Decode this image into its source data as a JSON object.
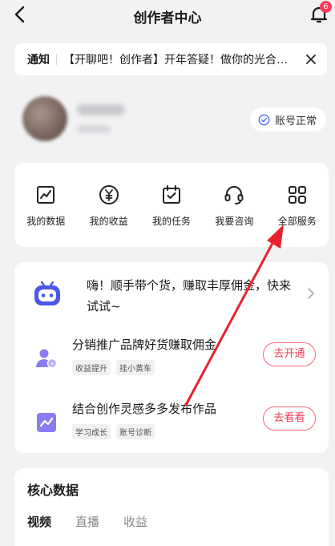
{
  "header": {
    "title": "创作者中心",
    "notification_count": "6"
  },
  "notice": {
    "tag": "通知",
    "text": "【开聊吧！创作者】开年答疑！做你的光合…"
  },
  "profile": {
    "status_label": "账号正常"
  },
  "services": [
    {
      "label": "我的数据",
      "icon": "chart-icon"
    },
    {
      "label": "我的收益",
      "icon": "yen-icon"
    },
    {
      "label": "我的任务",
      "icon": "task-icon"
    },
    {
      "label": "我要咨询",
      "icon": "headset-icon"
    },
    {
      "label": "全部服务",
      "icon": "grid-icon"
    }
  ],
  "promo": {
    "text": "嗨！顺手带个货，赚取丰厚佣金，快来试试~",
    "rows": [
      {
        "title": "分销推广品牌好货赚取佣金",
        "tags": [
          "收益提升",
          "挂小黄车"
        ],
        "button": "去开通",
        "icon": "user-coin-icon"
      },
      {
        "title": "结合创作灵感多多发布作品",
        "tags": [
          "学习成长",
          "账号诊断"
        ],
        "button": "去看看",
        "icon": "trend-icon"
      }
    ]
  },
  "core": {
    "title": "核心数据",
    "tabs": [
      "视频",
      "直播",
      "收益"
    ]
  },
  "colors": {
    "accent": "#ec3d57",
    "annotation": "#e8232f",
    "robot": "#4b58e8",
    "row_icon": "#8a7cf0"
  }
}
